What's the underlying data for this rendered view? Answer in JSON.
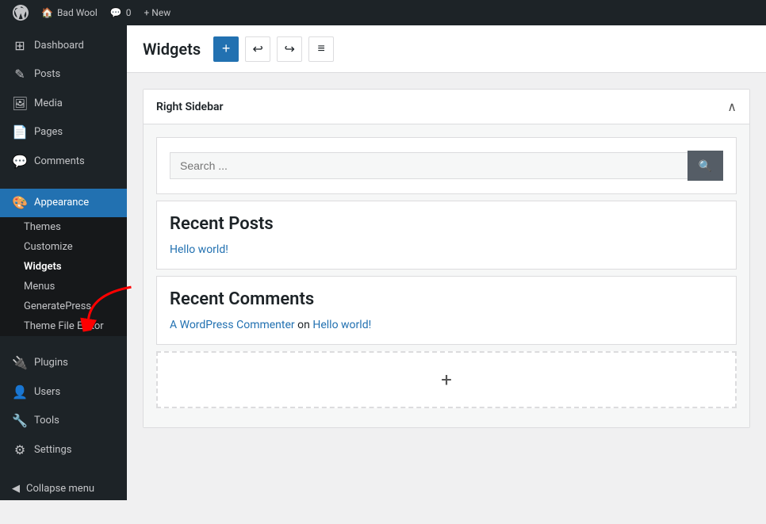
{
  "admin_bar": {
    "wp_label": "WordPress",
    "site_name": "Bad Wool",
    "comments_count": "0",
    "new_label": "+ New",
    "new_item_label": "New"
  },
  "sidebar": {
    "dashboard_label": "Dashboard",
    "posts_label": "Posts",
    "media_label": "Media",
    "pages_label": "Pages",
    "comments_label": "Comments",
    "appearance_label": "Appearance",
    "themes_label": "Themes",
    "customize_label": "Customize",
    "widgets_label": "Widgets",
    "menus_label": "Menus",
    "generatepress_label": "GeneratePress",
    "theme_file_editor_label": "Theme File Editor",
    "plugins_label": "Plugins",
    "users_label": "Users",
    "tools_label": "Tools",
    "settings_label": "Settings",
    "collapse_label": "Collapse menu"
  },
  "header": {
    "title": "Widgets",
    "add_block_label": "+",
    "undo_icon": "↩",
    "redo_icon": "↪",
    "options_icon": "≡"
  },
  "widget_area": {
    "title": "Right Sidebar",
    "toggle_icon": "∧"
  },
  "search_widget": {
    "placeholder": "Search ...",
    "button_icon": "🔍"
  },
  "recent_posts": {
    "title": "Recent Posts",
    "posts": [
      {
        "title": "Hello world!",
        "url": "#"
      }
    ]
  },
  "recent_comments": {
    "title": "Recent Comments",
    "comments": [
      {
        "author": "A WordPress Commenter",
        "on_text": "on",
        "post_title": "Hello world!"
      }
    ]
  },
  "add_block_btn": {
    "label": "+"
  }
}
